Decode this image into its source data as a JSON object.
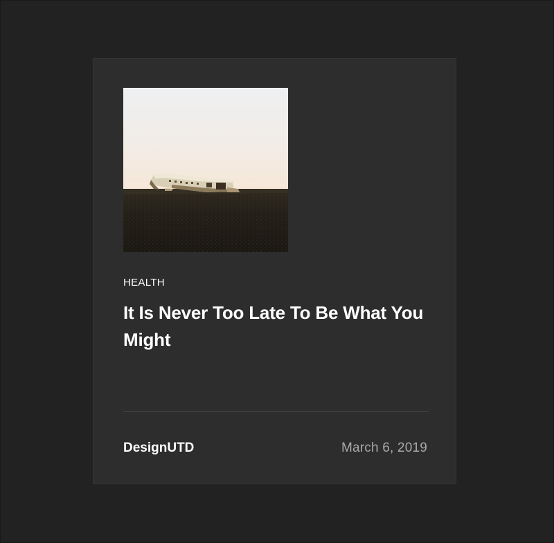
{
  "post": {
    "image_alt": "Abandoned plane wreck on a black sand beach under a pale sky",
    "category": "HEALTH",
    "title": "It Is Never Too Late To Be What You Might",
    "author": "DesignUTD",
    "date": "March 6, 2019"
  }
}
